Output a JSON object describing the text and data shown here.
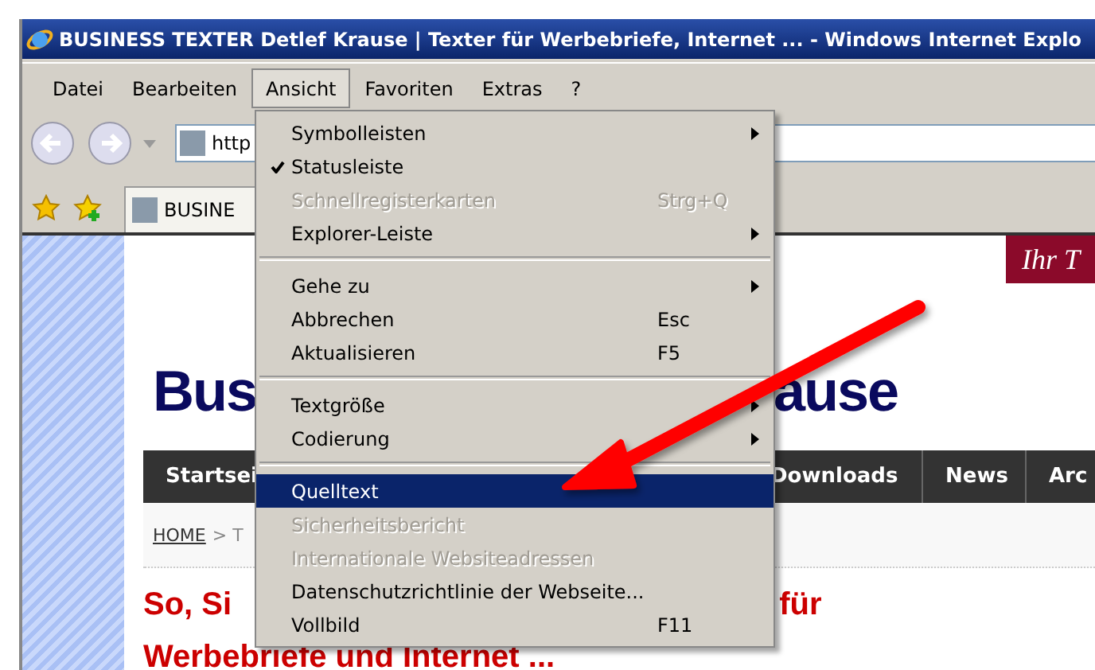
{
  "window": {
    "title": "BUSINESS TEXTER Detlef Krause | Texter für Werbebriefe, Internet ... - Windows Internet Explo"
  },
  "menu_bar": [
    {
      "label": "Datei",
      "selected": false
    },
    {
      "label": "Bearbeiten",
      "selected": false
    },
    {
      "label": "Ansicht",
      "selected": true
    },
    {
      "label": "Favoriten",
      "selected": false
    },
    {
      "label": "Extras",
      "selected": false
    },
    {
      "label": "?",
      "selected": false
    }
  ],
  "address": {
    "value": "http"
  },
  "tab": {
    "label": "BUSINE"
  },
  "page": {
    "banner": "Ihr T",
    "logo": [
      "Bus",
      "ause"
    ],
    "nav": [
      "Startsei",
      "Downloads",
      "News",
      "Arc"
    ],
    "breadcrumb": {
      "home": "HOME",
      "rest": "> T"
    },
    "headline": [
      "So, Si",
      "für"
    ],
    "headline_line2": "Werbebriefe und Internet ..."
  },
  "dropdown": [
    {
      "kind": "item",
      "label": "Symbolleisten",
      "submenu": true,
      "checked": false,
      "disabled": false,
      "selected": false
    },
    {
      "kind": "item",
      "label": "Statusleiste",
      "submenu": false,
      "checked": true,
      "disabled": false,
      "selected": false
    },
    {
      "kind": "item",
      "label": "Schnellregisterkarten",
      "shortcut": "Strg+Q",
      "submenu": false,
      "checked": false,
      "disabled": true,
      "selected": false
    },
    {
      "kind": "item",
      "label": "Explorer-Leiste",
      "submenu": true,
      "checked": false,
      "disabled": false,
      "selected": false
    },
    {
      "kind": "separator"
    },
    {
      "kind": "item",
      "label": "Gehe zu",
      "submenu": true,
      "checked": false,
      "disabled": false,
      "selected": false
    },
    {
      "kind": "item",
      "label": "Abbrechen",
      "shortcut": "Esc",
      "submenu": false,
      "checked": false,
      "disabled": false,
      "selected": false
    },
    {
      "kind": "item",
      "label": "Aktualisieren",
      "shortcut": "F5",
      "submenu": false,
      "checked": false,
      "disabled": false,
      "selected": false
    },
    {
      "kind": "separator"
    },
    {
      "kind": "item",
      "label": "Textgröße",
      "submenu": true,
      "checked": false,
      "disabled": false,
      "selected": false
    },
    {
      "kind": "item",
      "label": "Codierung",
      "submenu": true,
      "checked": false,
      "disabled": false,
      "selected": false
    },
    {
      "kind": "separator"
    },
    {
      "kind": "item",
      "label": "Quelltext",
      "submenu": false,
      "checked": false,
      "disabled": false,
      "selected": true
    },
    {
      "kind": "item",
      "label": "Sicherheitsbericht",
      "submenu": false,
      "checked": false,
      "disabled": true,
      "selected": false
    },
    {
      "kind": "item",
      "label": "Internationale Websiteadressen",
      "submenu": false,
      "checked": false,
      "disabled": true,
      "selected": false
    },
    {
      "kind": "item",
      "label": "Datenschutzrichtlinie der Webseite...",
      "submenu": false,
      "checked": false,
      "disabled": false,
      "selected": false
    },
    {
      "kind": "item",
      "label": "Vollbild",
      "shortcut": "F11",
      "submenu": false,
      "checked": false,
      "disabled": false,
      "selected": false
    }
  ]
}
